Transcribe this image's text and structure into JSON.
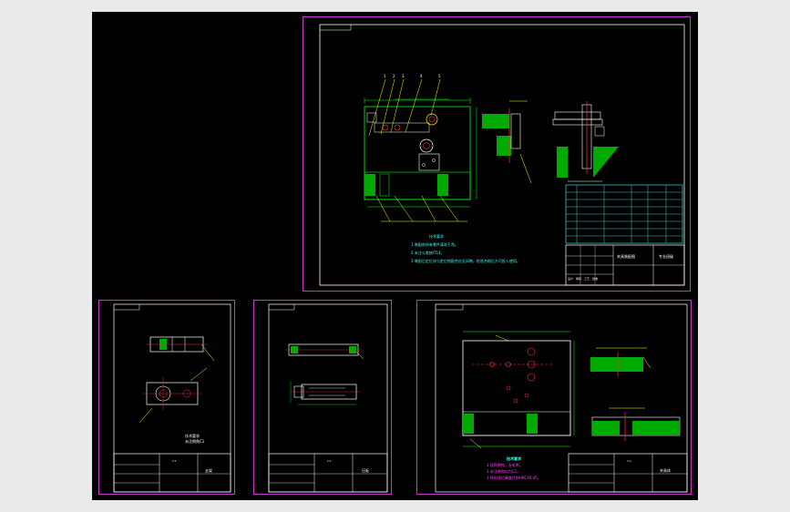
{
  "app": {
    "background": "#e9eaec",
    "canvas_background": "#000000"
  },
  "colors": {
    "sheet_border": "#cc33cc",
    "frame": "#ffffff",
    "outline": "#00ff00",
    "hatch": "#00cc00",
    "dimension": "#ffff00",
    "centerline": "#ff3333",
    "note": "#44ffff",
    "table": "#44ffff"
  },
  "sheets": {
    "assembly": {
      "notes_title": "技术要求",
      "notes": [
        "1 装配前所有零件清洗干净。",
        "2 未注公差按IT14。",
        "3 装配后定位块与定位销配合应无间隙，检验合格后方可投入使用。"
      ],
      "title_block": {
        "drawing_title": "夹具装配图",
        "school": "专业班级",
        "sign_labels": [
          "设计",
          "审核",
          "工艺",
          "批准"
        ]
      }
    },
    "part_a": {
      "notes": [
        "技术要求",
        "未注倒角C1"
      ],
      "title_block": {
        "drawing_title": "支架",
        "part_no": "1:1"
      }
    },
    "part_b": {
      "title_block": {
        "drawing_title": "压板",
        "part_no": "1:1"
      }
    },
    "part_c": {
      "notes_title": "技术要求",
      "notes": [
        "1 锐角倒钝，去毛刺。",
        "2 未注倒角均为C1。",
        "3 热处理后硬度达到HRC40-45。"
      ],
      "title_block": {
        "drawing_title": "夹具体",
        "part_no": "1:1"
      }
    }
  }
}
